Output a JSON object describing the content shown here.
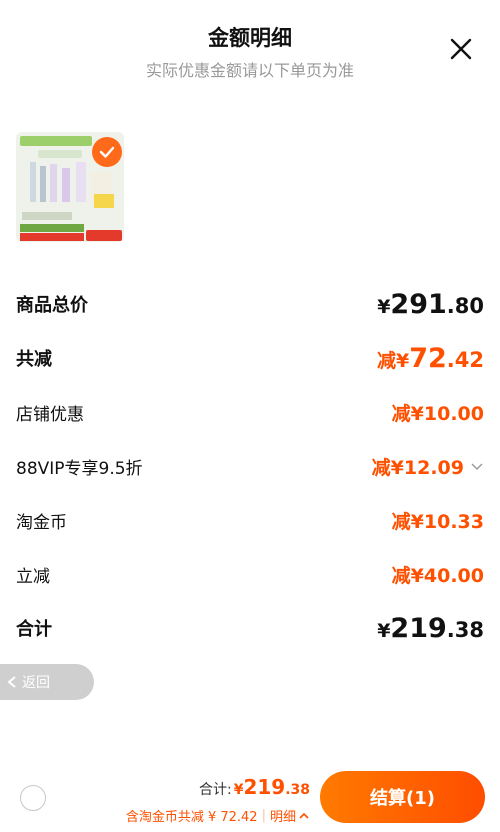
{
  "header": {
    "title": "金额明细",
    "subtitle": "实际优惠金额请以下单页为准"
  },
  "rows": {
    "subtotal": {
      "label": "商品总价",
      "yuan": "¥",
      "int": "291",
      "dec": ".80"
    },
    "total_discount": {
      "label": "共减",
      "prefix": "减¥",
      "int": "72",
      "dec": ".42"
    },
    "shop_discount": {
      "label": "店铺优惠",
      "prefix": "减¥",
      "int": "10",
      "dec": ".00"
    },
    "vip": {
      "label": "88VIP专享9.5折",
      "prefix": "减¥",
      "int": "12",
      "dec": ".09"
    },
    "coins": {
      "label": "淘金币",
      "prefix": "减¥",
      "int": "10",
      "dec": ".33"
    },
    "instant": {
      "label": "立减",
      "prefix": "减¥",
      "int": "40",
      "dec": ".00"
    },
    "total": {
      "label": "合计",
      "yuan": "¥",
      "int": "219",
      "dec": ".38"
    }
  },
  "back_label": "返回",
  "footer": {
    "total_label": "合计:",
    "yuan": "¥",
    "int": "219",
    "dec": ".38",
    "coin_text": "含淘金币共减 ¥ 72.42",
    "detail_label": "明细",
    "checkout_label": "结算(1)"
  },
  "colors": {
    "accent": "#ff5000",
    "checkout_start": "#ff7a00",
    "checkout_end": "#ff4d00"
  }
}
